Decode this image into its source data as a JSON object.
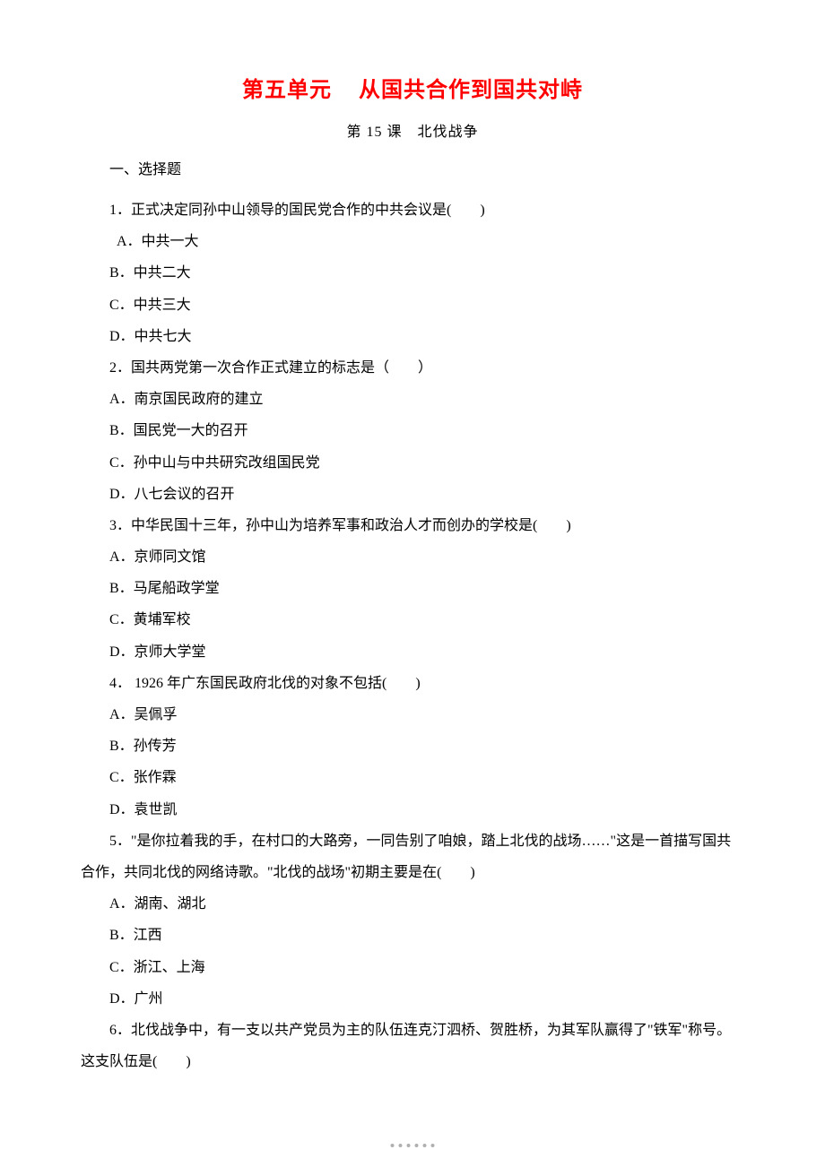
{
  "unit_title_a": "第五单元",
  "unit_title_b": "从国共合作到国共对峙",
  "lesson_title": "第 15 课　北伐战争",
  "section_heading": "一、选择题",
  "questions": [
    {
      "stem": "1．正式决定同孙中山领导的国民党合作的中共会议是(　　)",
      "options": [
        "A．中共一大",
        "B．中共二大",
        "C．中共三大",
        "D．中共七大"
      ],
      "first_indent": true
    },
    {
      "stem": "2．国共两党第一次合作正式建立的标志是（　　）",
      "options": [
        "A．南京国民政府的建立",
        "B．国民党一大的召开",
        "C．孙中山与中共研究改组国民党",
        "D．八七会议的召开"
      ],
      "first_indent": false
    },
    {
      "stem": "3．中华民国十三年，孙中山为培养军事和政治人才而创办的学校是(　　)",
      "options": [
        "A．京师同文馆",
        "B．马尾船政学堂",
        "C．黄埔军校",
        "D．京师大学堂"
      ],
      "first_indent": false
    },
    {
      "stem": "4．  1926 年广东国民政府北伐的对象不包括(　　)",
      "options": [
        "A．吴佩孚",
        "B．孙传芳",
        "C．张作霖",
        "D．袁世凯"
      ],
      "first_indent": false
    },
    {
      "stem": "5．\"是你拉着我的手，在村口的大路旁，一同告别了咱娘，踏上北伐的战场……\"这是一首描写国共合作，共同北伐的网络诗歌。\"北伐的战场\"初期主要是在(　　)",
      "options": [
        "A．湖南、湖北",
        "B．江西",
        "C．浙江、上海",
        "D．广州"
      ],
      "first_indent": false
    },
    {
      "stem": "6．北伐战争中，有一支以共产党员为主的队伍连克汀泗桥、贺胜桥，为其军队赢得了\"铁军\"称号。这支队伍是(　　)",
      "options": [],
      "first_indent": false
    }
  ]
}
